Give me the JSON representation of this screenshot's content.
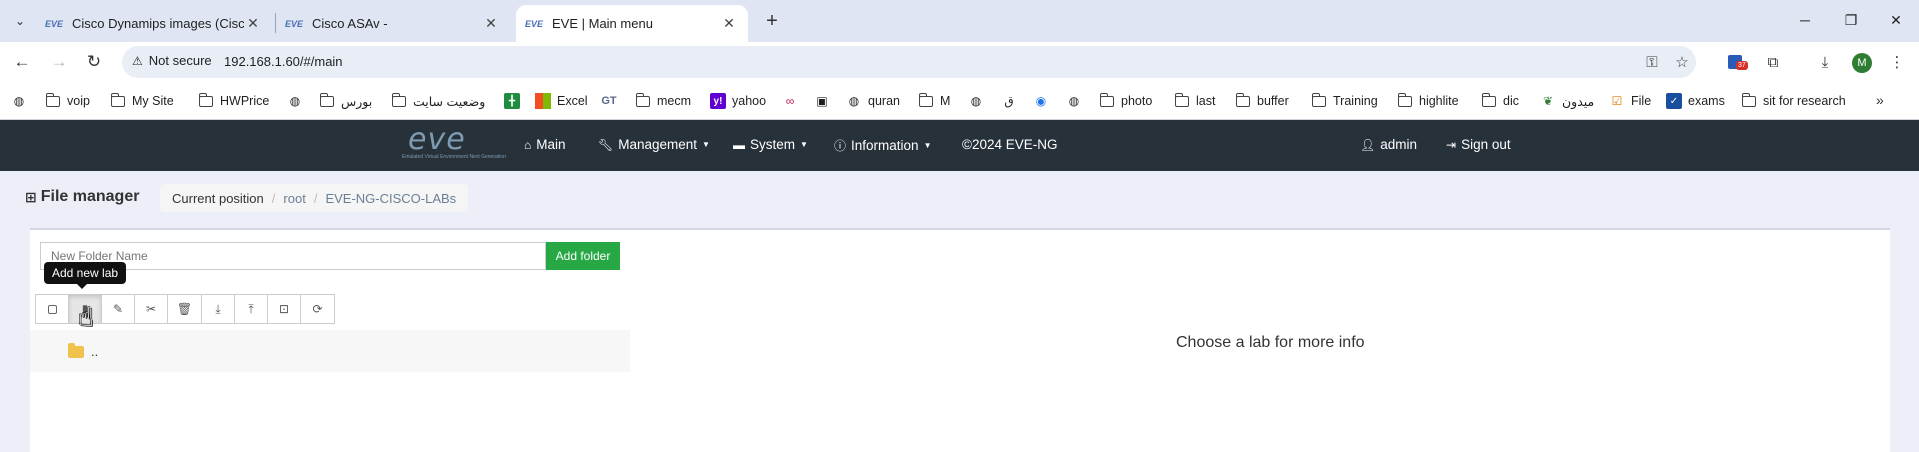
{
  "browser": {
    "tabs": [
      {
        "title": "Cisco Dynamips images (Cisco",
        "favicon": "eve-icon",
        "active": false
      },
      {
        "title": "Cisco ASAv -",
        "favicon": "eve-icon",
        "active": false
      },
      {
        "title": "EVE | Main menu",
        "favicon": "eve-icon",
        "active": true
      }
    ],
    "new_tab": "+",
    "security_label": "Not secure",
    "url": "192.168.1.60/#/main",
    "extension_badge": "37",
    "profile_initial": "M",
    "bookmarks": [
      {
        "label": "",
        "icon": "globe-icon"
      },
      {
        "label": "voip",
        "icon": "folder-icon"
      },
      {
        "label": "My Site",
        "icon": "folder-icon"
      },
      {
        "label": "HWPrice",
        "icon": "folder-icon"
      },
      {
        "label": "",
        "icon": "globe-icon"
      },
      {
        "label": "بورس",
        "icon": "folder-icon"
      },
      {
        "label": "وضعیت سایت",
        "icon": "folder-icon"
      },
      {
        "label": "",
        "icon": "sheets-icon"
      },
      {
        "label": "Excel",
        "icon": "microsoft-icon"
      },
      {
        "label": "",
        "icon": "gt-icon"
      },
      {
        "label": "mecm",
        "icon": "folder-icon"
      },
      {
        "label": "yahoo",
        "icon": "yahoo-icon"
      },
      {
        "label": "",
        "icon": "rings-icon"
      },
      {
        "label": "",
        "icon": "image-icon"
      },
      {
        "label": "quran",
        "icon": "globe-icon"
      },
      {
        "label": "M",
        "icon": "folder-icon"
      },
      {
        "label": "",
        "icon": "globe-icon"
      },
      {
        "label": "",
        "icon": "arabic-icon"
      },
      {
        "label": "",
        "icon": "edge-icon"
      },
      {
        "label": "",
        "icon": "globe-icon"
      },
      {
        "label": "photo",
        "icon": "folder-icon"
      },
      {
        "label": "last",
        "icon": "folder-icon"
      },
      {
        "label": "buffer",
        "icon": "folder-icon"
      },
      {
        "label": "Training",
        "icon": "folder-icon"
      },
      {
        "label": "highlite",
        "icon": "folder-icon"
      },
      {
        "label": "dic",
        "icon": "folder-icon"
      },
      {
        "label": "میدون",
        "icon": "leaf-icon"
      },
      {
        "label": "File",
        "icon": "checklist-icon"
      },
      {
        "label": "exams",
        "icon": "checkbox-icon"
      },
      {
        "label": "sit for research",
        "icon": "folder-icon"
      }
    ]
  },
  "eve": {
    "logo_text": "eve",
    "logo_tagline": "Emulated Virtual Environment Next Generation",
    "nav": [
      {
        "label": "Main",
        "icon": "home-icon",
        "caret": false
      },
      {
        "label": "Management",
        "icon": "wrench-icon",
        "caret": true
      },
      {
        "label": "System",
        "icon": "hdd-icon",
        "caret": true
      },
      {
        "label": "Information",
        "icon": "info-icon",
        "caret": true
      },
      {
        "label": "©2024 EVE-NG",
        "icon": "",
        "caret": false
      }
    ],
    "user": "admin",
    "signout": "Sign out"
  },
  "file_manager": {
    "title": "File manager",
    "breadcrumb": [
      "Current position",
      "root",
      "EVE-NG-CISCO-LABs"
    ],
    "folder_placeholder": "New Folder Name",
    "add_folder_label": "Add folder",
    "tooltip": "Add new lab",
    "up_folder_label": "..",
    "info_text": "Choose a lab for more info"
  },
  "colors": {
    "eve_navbar": "#273139",
    "content_bg": "#eceef8",
    "add_folder_green": "#28a745",
    "tabstrip": "#dfe5f3"
  }
}
